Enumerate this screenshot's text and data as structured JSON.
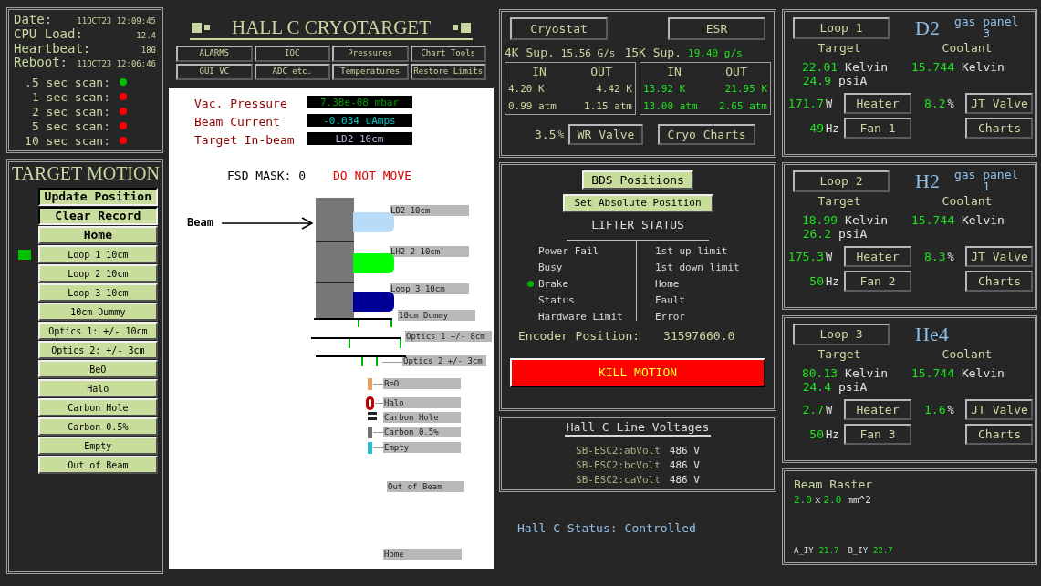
{
  "status": {
    "rows": [
      {
        "label": "Date:",
        "value": "11OCT23 12:09:45"
      },
      {
        "label": "CPU Load:",
        "value": "12.4"
      },
      {
        "label": "Heartbeat:",
        "value": "180"
      },
      {
        "label": "Reboot:",
        "value": "11OCT23 12:06:46"
      }
    ],
    "scans": [
      {
        "label": ".5 sec scan:",
        "color": "#00c000"
      },
      {
        "label": "1 sec scan:",
        "color": "#ff0000"
      },
      {
        "label": "2 sec scan:",
        "color": "#ff0000"
      },
      {
        "label": "5 sec scan:",
        "color": "#ff0000"
      },
      {
        "label": "10 sec scan:",
        "color": "#ff0000"
      }
    ]
  },
  "target_motion": {
    "title": "TARGET MOTION",
    "buttons": [
      {
        "label": "Update Position",
        "kind": "action"
      },
      {
        "label": "Clear Record",
        "kind": "action"
      },
      {
        "label": "Home",
        "kind": "home"
      },
      {
        "label": "Loop 1 10cm",
        "kind": "target",
        "selected": true
      },
      {
        "label": "Loop 2 10cm",
        "kind": "target",
        "selected": false
      },
      {
        "label": "Loop 3 10cm",
        "kind": "target",
        "selected": false
      },
      {
        "label": "10cm Dummy",
        "kind": "target",
        "selected": false
      },
      {
        "label": "Optics 1: +/- 10cm",
        "kind": "target",
        "selected": false
      },
      {
        "label": "Optics 2: +/- 3cm",
        "kind": "target",
        "selected": false
      },
      {
        "label": "BeO",
        "kind": "target",
        "selected": false
      },
      {
        "label": "Halo",
        "kind": "target",
        "selected": false
      },
      {
        "label": "Carbon Hole",
        "kind": "target",
        "selected": false
      },
      {
        "label": "Carbon 0.5%",
        "kind": "target",
        "selected": false
      },
      {
        "label": "Empty",
        "kind": "target",
        "selected": false
      },
      {
        "label": "Out of Beam",
        "kind": "target",
        "selected": false
      }
    ]
  },
  "title": "HALL C CRYOTARGET",
  "nav_buttons": [
    "ALARMS",
    "IOC",
    "Pressures",
    "Chart Tools",
    "GUI VC",
    "ADC etc.",
    "Temperatures",
    "Restore Limits"
  ],
  "readouts": [
    {
      "label": "Vac. Pressure",
      "value": "7.38e-08 mbar"
    },
    {
      "label": "Beam Current",
      "value": "-0.034 uAmps"
    },
    {
      "label": "Target In-beam",
      "value": "LD2 10cm"
    }
  ],
  "fsd_mask": {
    "label": "FSD MASK: 0",
    "warning": "DO NOT MOVE"
  },
  "diagram": {
    "beam_label": "Beam",
    "items": [
      {
        "kind": "cell",
        "label": "LD2 10cm",
        "color": "#b8dcf8"
      },
      {
        "kind": "cell",
        "label": "LH2 2 10cm",
        "color": "#00ff00"
      },
      {
        "kind": "cell",
        "label": "Loop 3 10cm",
        "color": "#000098"
      },
      {
        "kind": "dummy",
        "label": "10cm Dummy"
      },
      {
        "kind": "optics",
        "label": "Optics 1 +/- 8cm"
      },
      {
        "kind": "optics",
        "label": "Optics 2 +/- 3cm"
      },
      {
        "kind": "foil",
        "label": "BeO",
        "color": "#e8a060"
      },
      {
        "kind": "ring",
        "label": "Halo",
        "color": "#c00000"
      },
      {
        "kind": "hole",
        "label": "Carbon Hole"
      },
      {
        "kind": "foil",
        "label": "Carbon 0.5%",
        "color": "#707070"
      },
      {
        "kind": "foil",
        "label": "Empty",
        "color": "#20c0d0"
      },
      {
        "kind": "plain",
        "label": "Out of Beam"
      },
      {
        "kind": "plain",
        "label": "Home"
      }
    ]
  },
  "cryostat": {
    "buttons": [
      "Cryostat",
      "ESR"
    ],
    "supplies": [
      {
        "label": "4K Sup.",
        "value": "15.56 G/s",
        "color": "#c8d8a0"
      },
      {
        "label": "15K Sup.",
        "value": "19.40 g/s",
        "color": "#20e020"
      }
    ],
    "boxes": [
      {
        "in_label": "IN",
        "out_label": "OUT",
        "in_temp": "4.20 K",
        "out_temp": "4.42 K",
        "in_pressure": "0.99 atm",
        "out_pressure": "1.15 atm",
        "color": "#c8d8a0"
      },
      {
        "in_label": "IN",
        "out_label": "OUT",
        "in_temp": "13.92 K",
        "out_temp": "21.95 K",
        "in_pressure": "13.00 atm",
        "out_pressure": "2.65 atm",
        "color": "#20e020"
      }
    ],
    "valve_value": "3.5",
    "valve_unit": "%",
    "valve_button": "WR Valve",
    "charts_button": "Cryo Charts"
  },
  "lifter": {
    "bds_button": "BDS Positions",
    "set_button": "Set Absolute Position",
    "title": "LIFTER STATUS",
    "left": [
      {
        "label": "Power Fail",
        "on": false
      },
      {
        "label": "Busy",
        "on": false
      },
      {
        "label": "Brake",
        "on": true
      },
      {
        "label": "Status",
        "on": false
      },
      {
        "label": "Hardware Limit",
        "on": false
      }
    ],
    "right": [
      {
        "label": "1st up limit",
        "on": false
      },
      {
        "label": "1st down limit",
        "on": false
      },
      {
        "label": "Home",
        "on": false
      },
      {
        "label": "Fault",
        "on": false
      },
      {
        "label": "Error",
        "on": false
      }
    ],
    "encoder_label": "Encoder Position:",
    "encoder_value": "31597660.0",
    "kill_button": "KILL MOTION"
  },
  "line_voltages": {
    "title": "Hall C Line Voltages",
    "rows": [
      {
        "name": "SB-ESC2:abVolt",
        "value": "486 V"
      },
      {
        "name": "SB-ESC2:bcVolt",
        "value": "486 V"
      },
      {
        "name": "SB-ESC2:caVolt",
        "value": "486 V"
      }
    ]
  },
  "hall_status": {
    "label": "Hall C Status:",
    "value": "Controlled"
  },
  "loops": [
    {
      "button": "Loop 1",
      "gas": "D2",
      "gas_panel_label": "gas panel",
      "gas_panel_number": "3",
      "target_label": "Target",
      "coolant_label": "Coolant",
      "target_temp": "22.01",
      "target_temp_unit": "Kelvin",
      "target_pressure": "24.9",
      "target_pressure_unit": "psiA",
      "coolant_temp": "15.744",
      "coolant_temp_unit": "Kelvin",
      "heater_power": "171.7",
      "heater_unit": "W",
      "heater_button": "Heater",
      "fan_freq": "49",
      "fan_unit": "Hz",
      "fan_button": "Fan 1",
      "valve_value": "8.2",
      "valve_unit": "%",
      "valve_button": "JT Valve",
      "charts_button": "Charts"
    },
    {
      "button": "Loop 2",
      "gas": "H2",
      "gas_panel_label": "gas panel",
      "gas_panel_number": "1",
      "target_label": "Target",
      "coolant_label": "Coolant",
      "target_temp": "18.99",
      "target_temp_unit": "Kelvin",
      "target_pressure": "26.2",
      "target_pressure_unit": "psiA",
      "coolant_temp": "15.744",
      "coolant_temp_unit": "Kelvin",
      "heater_power": "175.3",
      "heater_unit": "W",
      "heater_button": "Heater",
      "fan_freq": "50",
      "fan_unit": "Hz",
      "fan_button": "Fan 2",
      "valve_value": "8.3",
      "valve_unit": "%",
      "valve_button": "JT Valve",
      "charts_button": "Charts"
    },
    {
      "button": "Loop 3",
      "gas": "He4",
      "target_label": "Target",
      "coolant_label": "Coolant",
      "target_temp": "80.13",
      "target_temp_unit": "Kelvin",
      "target_pressure": "24.4",
      "target_pressure_unit": "psiA",
      "coolant_temp": "15.744",
      "coolant_temp_unit": "Kelvin",
      "heater_power": "2.7",
      "heater_unit": "W",
      "heater_button": "Heater",
      "fan_freq": "50",
      "fan_unit": "Hz",
      "fan_button": "Fan 3",
      "valve_value": "1.6",
      "valve_unit": "%",
      "valve_button": "JT Valve",
      "charts_button": "Charts"
    }
  ],
  "raster": {
    "title": "Beam Raster",
    "x_size": "2.0",
    "times": "x",
    "y_size": "2.0",
    "unit": "mm^2",
    "currents": [
      {
        "label": "A_IY",
        "value": "21.7"
      },
      {
        "label": "B_IY",
        "value": "22.7"
      }
    ]
  }
}
